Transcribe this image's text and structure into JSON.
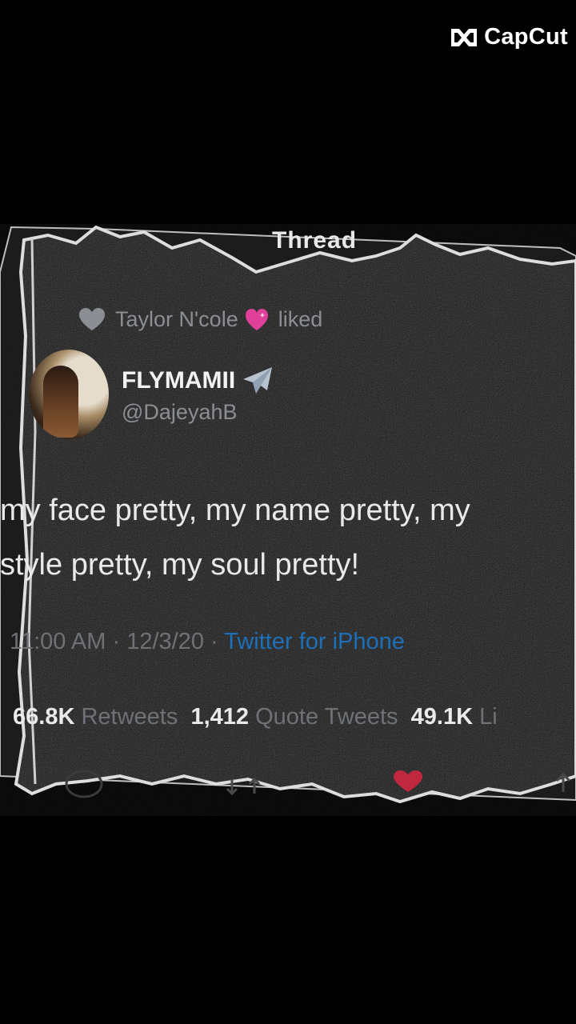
{
  "watermark": {
    "label": "CapCut"
  },
  "header": {
    "title": "Thread"
  },
  "social_context": {
    "liker": "Taylor N'cole",
    "action": "liked"
  },
  "tweet": {
    "display_name": "FLYMAMII",
    "handle": "@DajeyahB",
    "text_line1": "my face pretty, my name pretty, my",
    "text_line2": "style pretty, my soul pretty!",
    "time": "11:00 AM",
    "date": "12/3/20",
    "separator": "·",
    "source": "Twitter for iPhone",
    "retweets_count": "66.8K",
    "retweets_label": "Retweets",
    "quote_count": "1,412",
    "quote_label": "Quote Tweets",
    "likes_count": "49.1K",
    "likes_label": "Li"
  },
  "icons": {
    "like_context": "heart-icon",
    "name_emoji": "pink-heart-icon",
    "name_badge": "airplane-icon",
    "reply": "reply-icon",
    "retweet": "retweet-icon",
    "like": "like-icon",
    "share": "share-icon"
  },
  "colors": {
    "background": "#000000",
    "text_primary": "#e9e9e9",
    "text_secondary": "#8b8f94",
    "link": "#1d6fb8",
    "pink_heart": "#e0409a"
  }
}
